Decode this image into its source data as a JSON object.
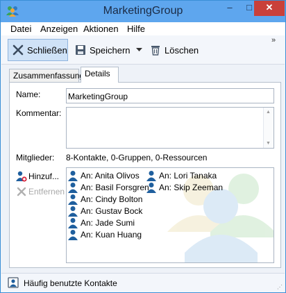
{
  "window": {
    "title": "MarketingGroup",
    "controls": {
      "minimize": "–",
      "maximize": "□",
      "close": "✕"
    }
  },
  "menu": [
    "Datei",
    "Anzeigen",
    "Aktionen",
    "Hilfe"
  ],
  "toolbar": {
    "close_label": "Schließen",
    "save_label": "Speichern",
    "delete_label": "Löschen",
    "overflow": "»"
  },
  "tabs": {
    "summary": "Zusammenfassung",
    "details": "Details",
    "selected": "Details"
  },
  "form": {
    "name_label": "Name:",
    "name_value": "MarketingGroup",
    "comment_label": "Kommentar:",
    "comment_value": "",
    "members_label": "Mitglieder:",
    "members_summary": "8-Kontakte, 0-Gruppen, 0-Ressourcen",
    "add_label": "Hinzuf...",
    "remove_label": "Entfernen"
  },
  "members": [
    "An: Anita Olivos",
    "An: Basil Forsgren",
    "An: Cindy Bolton",
    "An: Gustav Bock",
    "An: Jade Sumi",
    "An: Kuan Huang",
    "An: Lori Tanaka",
    "An: Skip Zeeman"
  ],
  "status": {
    "text": "Häufig benutzte Kontakte"
  },
  "colors": {
    "titlebar": "#5ea6ee",
    "close": "#c9403a",
    "contact_icon": "#1f5f9e",
    "accent": "#3a8fd6"
  }
}
